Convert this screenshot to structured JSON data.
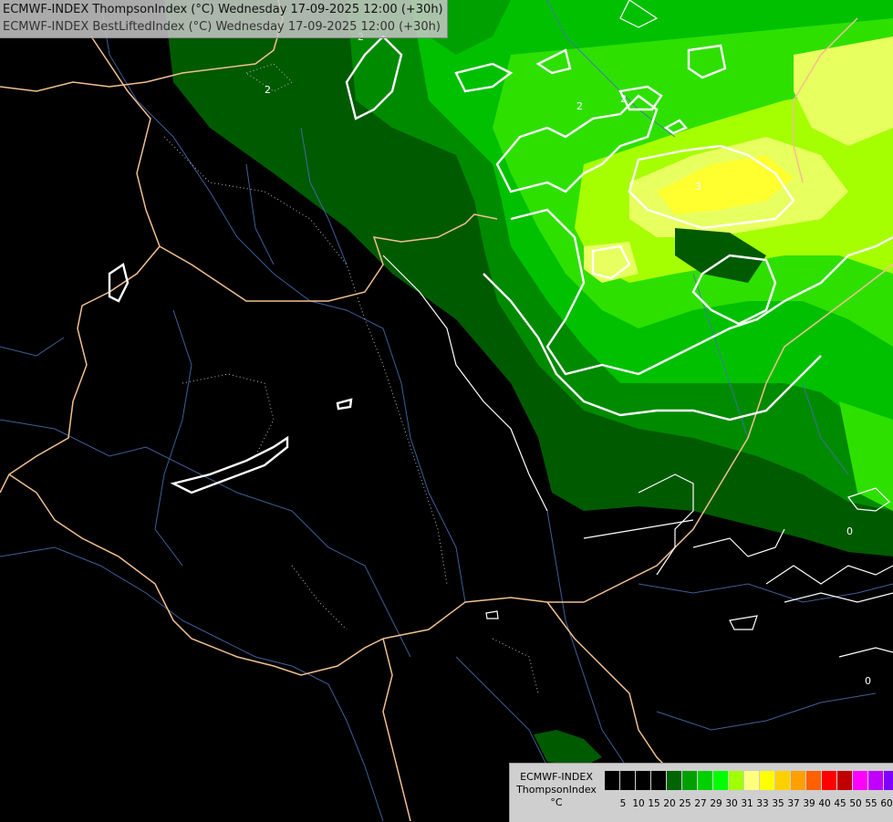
{
  "title": {
    "line1": "ECMWF-INDEX ThompsonIndex (°C) Wednesday 17-09-2025 12:00 (+30h)",
    "line2": "ECMWF-INDEX BestLiftedIndex (°C) Wednesday 17-09-2025 12:00 (+30h)"
  },
  "contour_labels": [
    "2",
    "2",
    "2",
    "3",
    "2",
    "0",
    "0"
  ],
  "legend": {
    "model": "ECMWF-INDEX",
    "field": "ThompsonIndex",
    "unit": "°C",
    "colors": [
      "#000000",
      "#000000",
      "#000000",
      "#000000",
      "#006400",
      "#00a000",
      "#00d000",
      "#00ff00",
      "#a0ff00",
      "#ffff80",
      "#ffff00",
      "#ffd000",
      "#ffa000",
      "#ff6000",
      "#ff0000",
      "#c00000",
      "#ff00ff",
      "#c000ff",
      "#8000ff",
      "#0000ff"
    ],
    "tick_labels": [
      "5",
      "10",
      "15",
      "20",
      "25",
      "27",
      "29",
      "30",
      "31",
      "33",
      "35",
      "37",
      "39",
      "40",
      "45",
      "50",
      "55",
      "60"
    ]
  }
}
